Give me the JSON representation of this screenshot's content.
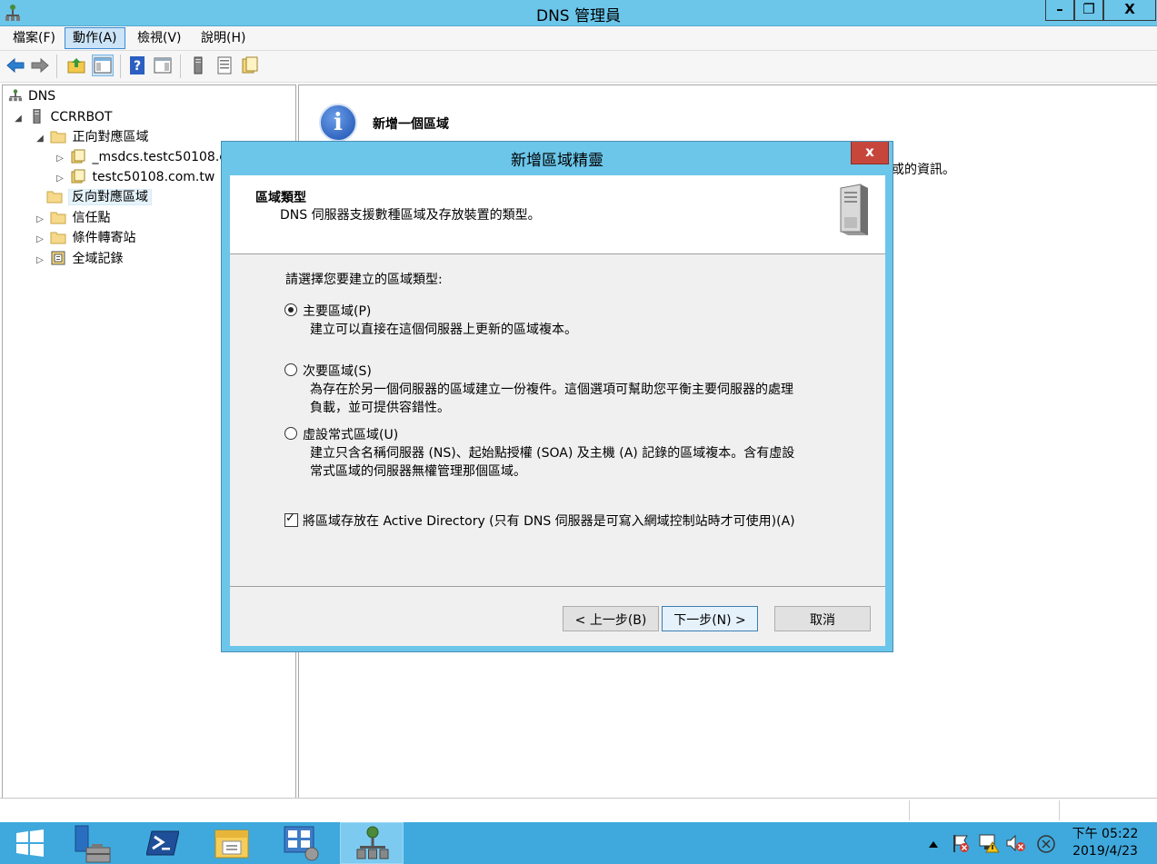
{
  "window": {
    "title": "DNS 管理員",
    "min": "–",
    "max": "❐",
    "close": "X"
  },
  "menu": {
    "items": [
      "檔案(F)",
      "動作(A)",
      "檢視(V)",
      "說明(H)"
    ]
  },
  "tree": {
    "root": "DNS",
    "server": "CCRRBOT",
    "forward": "正向對應區域",
    "forward_children": [
      "_msdcs.testc50108.c",
      "testc50108.com.tw"
    ],
    "reverse": "反向對應區域",
    "trust": "信任點",
    "conditional": "條件轉寄站",
    "global": "全域記錄"
  },
  "right_panel": {
    "heading": "新增一個區域",
    "partial_text": "或的資訊。"
  },
  "wizard": {
    "title": "新增區域精靈",
    "close": "x",
    "header_title": "區域類型",
    "header_subtitle": "DNS 伺服器支援數種區域及存放裝置的類型。",
    "prompt": "請選擇您要建立的區域類型:",
    "options": [
      {
        "label": "主要區域(P)",
        "desc": [
          "建立可以直接在這個伺服器上更新的區域複本。"
        ],
        "checked": true
      },
      {
        "label": "次要區域(S)",
        "desc": [
          "為存在於另一個伺服器的區域建立一份複件。這個選項可幫助您平衡主要伺服器的處理",
          "負載，並可提供容錯性。"
        ],
        "checked": false
      },
      {
        "label": "虛設常式區域(U)",
        "desc": [
          "建立只含名稱伺服器 (NS)、起始點授權 (SOA) 及主機 (A) 記錄的區域複本。含有虛設",
          "常式區域的伺服器無權管理那個區域。"
        ],
        "checked": false
      }
    ],
    "ad_checkbox": {
      "label": "將區域存放在 Active Directory (只有 DNS 伺服器是可寫入網域控制站時才可使用)(A)",
      "checked": true
    },
    "buttons": {
      "back": "< 上一步(B)",
      "next": "下一步(N) >",
      "cancel": "取消"
    }
  },
  "taskbar": {
    "time": "下午 05:22",
    "date": "2019/4/23"
  }
}
